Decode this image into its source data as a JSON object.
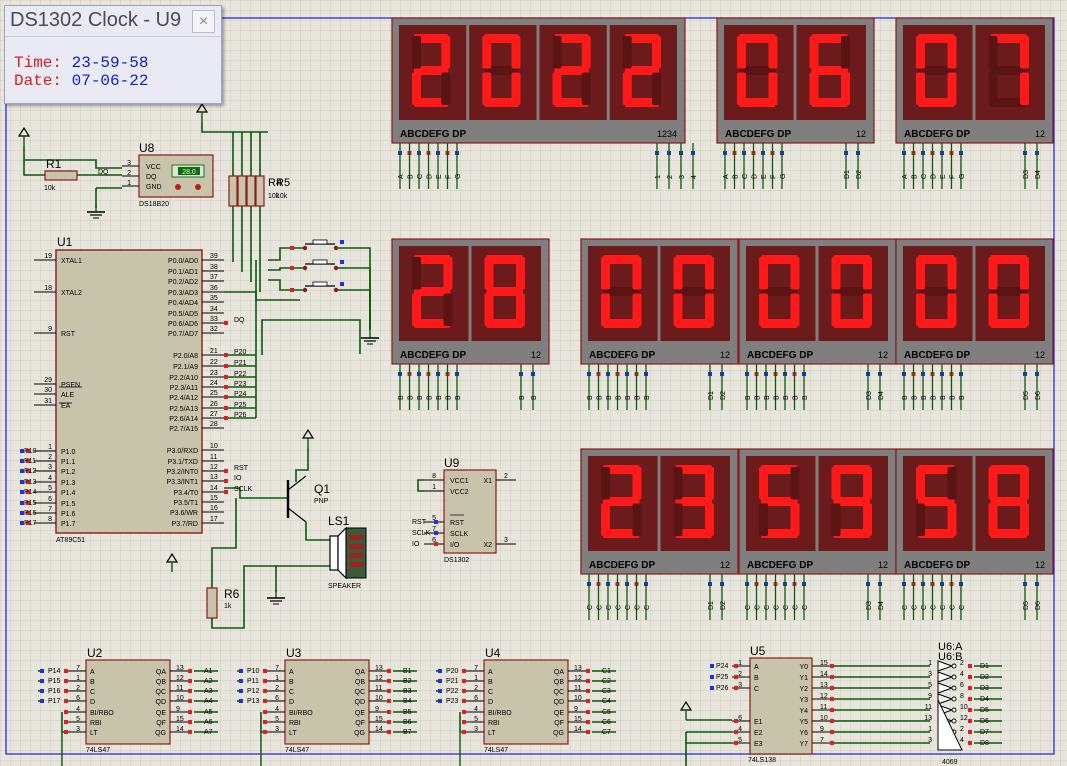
{
  "popup": {
    "title": "DS1302 Clock - U9",
    "close": "×",
    "time_label": "Time:",
    "time_value": "23-59-58",
    "date_label": "Date:",
    "date_value": "07-06-22"
  },
  "displays": {
    "year": {
      "digits": "2022",
      "seg_label": "ABCDEFG  DP",
      "com_label": "1234",
      "pins": [
        "A",
        "B",
        "C",
        "D",
        "E",
        "F",
        "G",
        "",
        "1",
        "2",
        "3",
        "4"
      ]
    },
    "month": {
      "digits": "06",
      "seg_label": "ABCDEFG  DP",
      "com_label": "12",
      "pins": [
        "A",
        "B",
        "C",
        "D",
        "E",
        "F",
        "G",
        "",
        "D1",
        "D2"
      ]
    },
    "day": {
      "digits": "07",
      "seg_label": "ABCDEFG  DP",
      "com_label": "12",
      "pins": [
        "A",
        "B",
        "C",
        "D",
        "E",
        "F",
        "G",
        "",
        "D3",
        "D4"
      ]
    },
    "temp": {
      "digits": "28",
      "seg_label": "ABCDEFG  DP",
      "com_label": "12",
      "pins": [
        "B",
        "B",
        "B",
        "B",
        "B",
        "B",
        "B",
        "",
        "B",
        "B"
      ]
    },
    "r2a": {
      "digits": "00",
      "seg_label": "ABCDEFG  DP",
      "com_label": "12",
      "pins": [
        "B",
        "B",
        "B",
        "B",
        "B",
        "B",
        "B",
        "",
        "D1",
        "D2"
      ]
    },
    "r2b": {
      "digits": "00",
      "seg_label": "ABCDEFG  DP",
      "com_label": "12",
      "pins": [
        "B",
        "B",
        "B",
        "B",
        "B",
        "B",
        "B",
        "",
        "D3",
        "D4"
      ]
    },
    "r2c": {
      "digits": "00",
      "seg_label": "ABCDEFG  DP",
      "com_label": "12",
      "pins": [
        "B",
        "B",
        "B",
        "B",
        "B",
        "B",
        "B",
        "",
        "D5",
        "D6"
      ]
    },
    "hour": {
      "digits": "23",
      "seg_label": "ABCDEFG  DP",
      "com_label": "12",
      "pins": [
        "C",
        "C",
        "C",
        "C",
        "C",
        "C",
        "C",
        "",
        "D1",
        "D2"
      ]
    },
    "minute": {
      "digits": "59",
      "seg_label": "ABCDEFG  DP",
      "com_label": "12",
      "pins": [
        "C",
        "C",
        "C",
        "C",
        "C",
        "C",
        "C",
        "",
        "D3",
        "D4"
      ]
    },
    "second": {
      "digits": "58",
      "seg_label": "ABCDEFG  DP",
      "com_label": "12",
      "pins": [
        "C",
        "C",
        "C",
        "C",
        "C",
        "C",
        "C",
        "",
        "D5",
        "D6"
      ]
    }
  },
  "u1": {
    "ref": "U1",
    "part": "AT89C51",
    "left_pins": [
      {
        "num": "19",
        "name": "XTAL1"
      },
      {
        "num": "18",
        "name": "XTAL2"
      },
      {
        "num": "9",
        "name": "RST"
      },
      {
        "num": "29",
        "name": "PSEN"
      },
      {
        "num": "30",
        "name": "ALE"
      },
      {
        "num": "31",
        "name": "EA"
      },
      {
        "num": "1",
        "name": "P1.0"
      },
      {
        "num": "2",
        "name": "P1.1"
      },
      {
        "num": "3",
        "name": "P1.2"
      },
      {
        "num": "4",
        "name": "P1.3"
      },
      {
        "num": "5",
        "name": "P1.4"
      },
      {
        "num": "6",
        "name": "P1.5"
      },
      {
        "num": "7",
        "name": "P1.6"
      },
      {
        "num": "8",
        "name": "P1.7"
      }
    ],
    "left_nets": [
      "P10",
      "P11",
      "P12",
      "P13",
      "P14",
      "P15",
      "P16",
      "P17"
    ],
    "right_pins": [
      {
        "num": "39",
        "name": "P0.0/AD0"
      },
      {
        "num": "38",
        "name": "P0.1/AD1"
      },
      {
        "num": "37",
        "name": "P0.2/AD2"
      },
      {
        "num": "36",
        "name": "P0.3/AD3"
      },
      {
        "num": "35",
        "name": "P0.4/AD4"
      },
      {
        "num": "34",
        "name": "P0.5/AD5"
      },
      {
        "num": "33",
        "name": "P0.6/AD6"
      },
      {
        "num": "32",
        "name": "P0.7/AD7"
      },
      {
        "num": "21",
        "name": "P2.0/A8"
      },
      {
        "num": "22",
        "name": "P2.1/A9"
      },
      {
        "num": "23",
        "name": "P2.2/A10"
      },
      {
        "num": "24",
        "name": "P2.3/A11"
      },
      {
        "num": "25",
        "name": "P2.4/A12"
      },
      {
        "num": "26",
        "name": "P2.5/A13"
      },
      {
        "num": "27",
        "name": "P2.6/A14"
      },
      {
        "num": "28",
        "name": "P2.7/A15"
      },
      {
        "num": "10",
        "name": "P3.0/RXD"
      },
      {
        "num": "11",
        "name": "P3.1/TXD"
      },
      {
        "num": "12",
        "name": "P3.2/INT0"
      },
      {
        "num": "13",
        "name": "P3.3/INT1"
      },
      {
        "num": "14",
        "name": "P3.4/T0"
      },
      {
        "num": "15",
        "name": "P3.5/T1"
      },
      {
        "num": "16",
        "name": "P3.6/WR"
      },
      {
        "num": "17",
        "name": "P3.7/RD"
      }
    ],
    "right_nets": [
      "",
      "",
      "",
      "",
      "",
      "",
      "DQ",
      "",
      "P20",
      "P21",
      "P22",
      "P23",
      "P24",
      "P25",
      "P26",
      "",
      "",
      "",
      "RST",
      "IO",
      "SCLK",
      "",
      "",
      ""
    ]
  },
  "u8": {
    "ref": "U8",
    "part": "DS18B20",
    "pins": [
      "VCC",
      "DQ",
      "GND"
    ],
    "nums": [
      "3",
      "2",
      "1"
    ],
    "reading": "28.0",
    "net": "DQ"
  },
  "r1": {
    "ref": "R1",
    "value": "10k"
  },
  "r4": {
    "ref": "R4",
    "value": "10k"
  },
  "r5": {
    "ref": "R5",
    "value": "10k"
  },
  "r6": {
    "ref": "R6",
    "value": "1k"
  },
  "q1": {
    "ref": "Q1",
    "part": "PNP"
  },
  "ls1": {
    "ref": "LS1",
    "part": "SPEAKER"
  },
  "u9": {
    "ref": "U9",
    "part": "DS1302",
    "pins_left": [
      "VCC1",
      "VCC2",
      "RST",
      "SCLK",
      "I/O"
    ],
    "nums_left": [
      "8",
      "1",
      "5",
      "7",
      "6"
    ],
    "pins_right": [
      "X1",
      "X2"
    ],
    "nums_right": [
      "2",
      "3"
    ],
    "nets": [
      "RST",
      "SCLK",
      "IO"
    ]
  },
  "u2": {
    "ref": "U2",
    "part": "74LS47",
    "in_nets": [
      "P14",
      "P15",
      "P16",
      "P17"
    ],
    "in_nums": [
      "7",
      "1",
      "2",
      "6"
    ],
    "ctrl_nums": [
      "4",
      "5",
      "3"
    ],
    "out_nets": [
      "A1",
      "A2",
      "A3",
      "A4",
      "A5",
      "A6",
      "A7"
    ]
  },
  "u3": {
    "ref": "U3",
    "part": "74LS47",
    "in_nets": [
      "P10",
      "P11",
      "P12",
      "P13"
    ],
    "in_nums": [
      "7",
      "1",
      "2",
      "6"
    ],
    "ctrl_nums": [
      "4",
      "5",
      "3"
    ],
    "out_nets": [
      "B1",
      "B2",
      "B3",
      "B4",
      "B5",
      "B6",
      "B7"
    ]
  },
  "u4": {
    "ref": "U4",
    "part": "74LS47",
    "in_nets": [
      "P20",
      "P21",
      "P22",
      "P23"
    ],
    "in_nums": [
      "7",
      "1",
      "2",
      "6"
    ],
    "ctrl_nums": [
      "4",
      "5",
      "3"
    ],
    "out_nets": [
      "C1",
      "C2",
      "C3",
      "C4",
      "C5",
      "C6",
      "C7"
    ]
  },
  "u5": {
    "ref": "U5",
    "part": "74LS138",
    "in_nets": [
      "P24",
      "P25",
      "P26"
    ],
    "in_nums": [
      "1",
      "2",
      "3"
    ],
    "en_nums": [
      "6",
      "4",
      "5"
    ],
    "in_pins": [
      "A",
      "B",
      "C"
    ],
    "en_pins": [
      "E1",
      "E2",
      "E3"
    ],
    "out_pins": [
      "Y0",
      "Y1",
      "Y2",
      "Y3",
      "Y4",
      "Y5",
      "Y6",
      "Y7"
    ],
    "out_nums": [
      "15",
      "14",
      "13",
      "12",
      "11",
      "10",
      "9",
      "7"
    ]
  },
  "u6": {
    "ref": "U6:A",
    "ref2": "U6:B",
    "part": "4069",
    "in_nums": [
      "1",
      "3",
      "5",
      "9",
      "11",
      "13",
      "1",
      "3"
    ],
    "out_nums": [
      "2",
      "4",
      "6",
      "8",
      "10",
      "12",
      "2",
      "4"
    ],
    "out_nets": [
      "D1",
      "D2",
      "D3",
      "D4",
      "D5",
      "D6",
      "D7",
      "D8"
    ]
  },
  "decoder_pin_names": [
    "A",
    "B",
    "C",
    "D",
    "BI/RBO",
    "RBI",
    "LT"
  ],
  "decoder_out_names": [
    "QA",
    "QB",
    "QC",
    "QD",
    "QE",
    "QF",
    "QG"
  ],
  "decoder_out_nums": [
    "13",
    "12",
    "11",
    "10",
    "9",
    "15",
    "14"
  ],
  "colors": {
    "bg": "#e8e6dc",
    "grid": "#cfccbf",
    "wire": "#0a5a0a",
    "body": "#c8c4ac",
    "outline": "#8b1a1a",
    "seg": "#ff1a1a",
    "display": "#6b1b1b",
    "bezel": "#7f7f7f",
    "pin_red": "#e02020",
    "pin_blue": "#2030e0",
    "frame": "#1a1ae0"
  }
}
